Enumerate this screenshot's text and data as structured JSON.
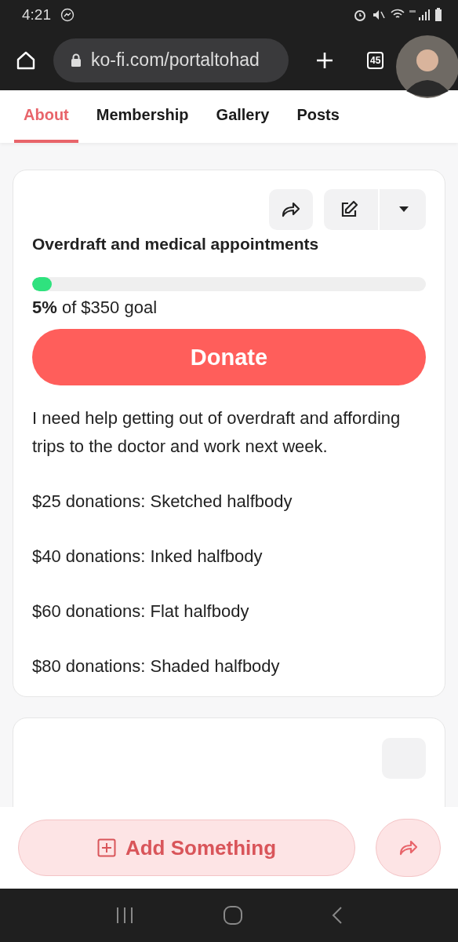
{
  "status_bar": {
    "time": "4:21"
  },
  "browser": {
    "url": "ko-fi.com/portaltohad",
    "tab_count": "45"
  },
  "tabs": [
    {
      "label": "About",
      "selected": true
    },
    {
      "label": "Membership",
      "selected": false
    },
    {
      "label": "Gallery",
      "selected": false
    },
    {
      "label": "Posts",
      "selected": false
    }
  ],
  "goal": {
    "title": "Overdraft and medical appointments",
    "level": 0.05,
    "percent": "5%",
    "caption": " of $350 goal",
    "donate_button": "Donate",
    "description": [
      "I need help getting out of overdraft and affording trips to the doctor and work next week.",
      "$25 donations: Sketched halfbody",
      "$40 donations: Inked halfbody",
      "$60 donations: Flat halfbody",
      "$80 donations: Shaded halfbody"
    ]
  },
  "bottom_bar": {
    "add_button": "Add Something"
  }
}
